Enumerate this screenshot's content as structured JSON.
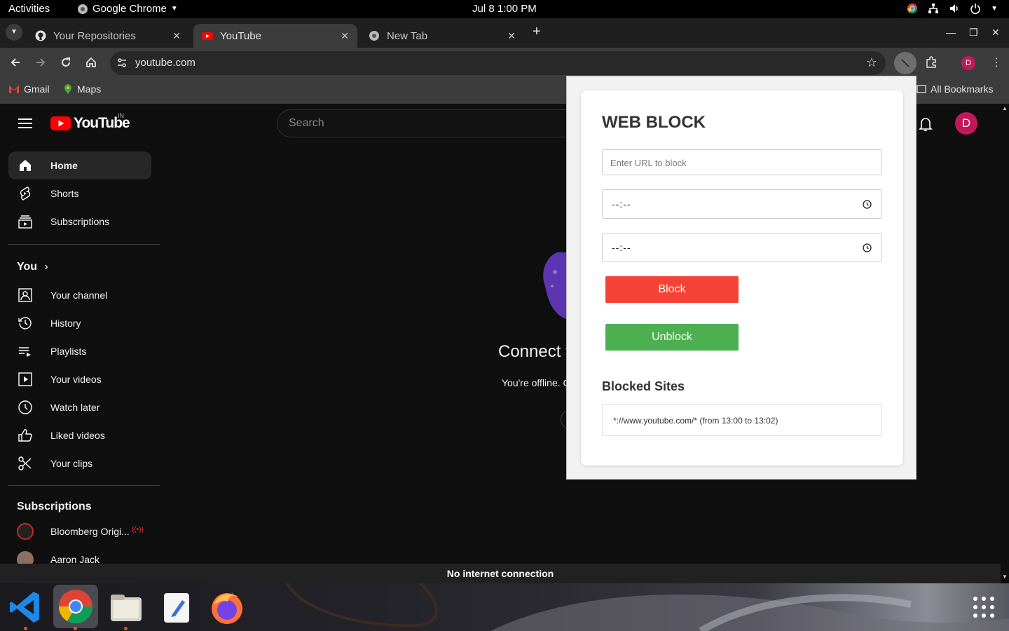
{
  "topbar": {
    "activities": "Activities",
    "app_name": "Google Chrome",
    "clock": "Jul 8  1:00 PM"
  },
  "tabs": [
    {
      "label": "Your Repositories",
      "icon": "github-icon",
      "active": false
    },
    {
      "label": "YouTube",
      "icon": "youtube-icon",
      "active": true
    },
    {
      "label": "New Tab",
      "icon": "chrome-icon",
      "active": false
    }
  ],
  "toolbar": {
    "url": "youtube.com"
  },
  "bookmarks": {
    "items": [
      {
        "label": "Gmail",
        "icon": "gmail-icon"
      },
      {
        "label": "Maps",
        "icon": "maps-icon"
      }
    ],
    "all_bookmarks": "All Bookmarks"
  },
  "youtube": {
    "logo_text": "YouTube",
    "country": "IN",
    "search_placeholder": "Search",
    "avatar_letter": "D",
    "nav_main": [
      {
        "label": "Home",
        "icon": "home-icon",
        "active": true
      },
      {
        "label": "Shorts",
        "icon": "shorts-icon"
      },
      {
        "label": "Subscriptions",
        "icon": "subscriptions-icon"
      }
    ],
    "you_heading": "You",
    "nav_you": [
      {
        "label": "Your channel",
        "icon": "channel-icon"
      },
      {
        "label": "History",
        "icon": "history-icon"
      },
      {
        "label": "Playlists",
        "icon": "playlists-icon"
      },
      {
        "label": "Your videos",
        "icon": "your-videos-icon"
      },
      {
        "label": "Watch later",
        "icon": "watch-later-icon"
      },
      {
        "label": "Liked videos",
        "icon": "liked-icon"
      },
      {
        "label": "Your clips",
        "icon": "clips-icon"
      }
    ],
    "subscriptions_heading": "Subscriptions",
    "subscriptions": [
      {
        "label": "Bloomberg Origi...",
        "live": true
      },
      {
        "label": "Aaron Jack",
        "live": false
      }
    ],
    "offline_title": "Connect t",
    "offline_sub": "You're offline. C",
    "offline_bar": "No internet connection"
  },
  "popup": {
    "title": "WEB BLOCK",
    "url_placeholder": "Enter URL to block",
    "start_time": "--:--",
    "end_time": "--:--",
    "block_label": "Block",
    "unblock_label": "Unblock",
    "blocked_heading": "Blocked Sites",
    "blocked_sites": [
      "*://www.youtube.com/* (from 13:00 to 13:02)"
    ],
    "colors": {
      "block": "#f44336",
      "unblock": "#4caf50"
    }
  },
  "dock": {
    "apps": [
      "vscode-icon",
      "chrome-icon",
      "files-icon",
      "text-editor-icon",
      "firefox-icon",
      "app-grid-icon"
    ]
  }
}
